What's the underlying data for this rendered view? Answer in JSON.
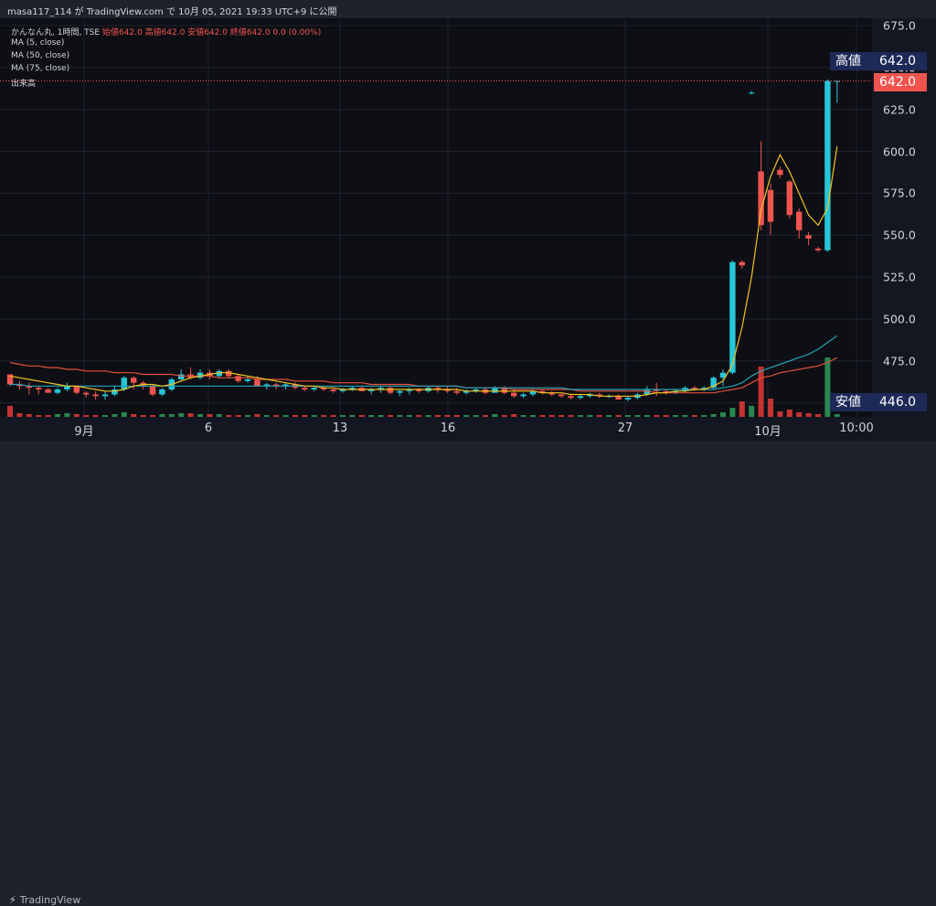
{
  "topbar": {
    "text": "masa117_114 が TradingView.com で 10月 05, 2021 19:33 UTC+9 に公開"
  },
  "legend": {
    "title": "かんなん丸, 1時間, TSE",
    "ohlc": "始値642.0 高値642.0 安値642.0 終値642.0 0.0 (0.00%)",
    "ma5": "MA (5, close)",
    "ma50": "MA (50, close)",
    "ma75": "MA (75, close)",
    "volume": "出来高"
  },
  "price_labels": {
    "high_label": "高値",
    "high_value": "642.0",
    "last_value": "642.0",
    "low_label": "安値",
    "low_value": "446.0"
  },
  "footer": {
    "brand": "TradingView"
  },
  "colors": {
    "up": "#26c6da",
    "down": "#f0544f",
    "ma5": "#f2c21f",
    "ma50": "#26a2b8",
    "ma75": "#e0503c",
    "vol_up": "#2e9c5a",
    "vol_down": "#e53935",
    "label_navy": "#1d2a58"
  },
  "chart_data": {
    "type": "candlestick",
    "ylim": [
      446,
      675
    ],
    "y_ticks": [
      675.0,
      650.0,
      625.0,
      600.0,
      575.0,
      550.0,
      525.0,
      500.0,
      475.0,
      450.0
    ],
    "x_tick_labels": [
      "9月",
      "6",
      "13",
      "16",
      "27",
      "10月",
      "10:00"
    ],
    "candles": [
      [
        467,
        467,
        460,
        461
      ],
      [
        461,
        463,
        458,
        460
      ],
      [
        460,
        462,
        455,
        459
      ],
      [
        459,
        460,
        455,
        458
      ],
      [
        458,
        459,
        457,
        456
      ],
      [
        456,
        459,
        455,
        458
      ],
      [
        458,
        462,
        457,
        460
      ],
      [
        460,
        460,
        455,
        456
      ],
      [
        456,
        457,
        453,
        455
      ],
      [
        455,
        457,
        452,
        454
      ],
      [
        454,
        457,
        452,
        455
      ],
      [
        455,
        460,
        454,
        458
      ],
      [
        458,
        466,
        457,
        465
      ],
      [
        465,
        466,
        458,
        462
      ],
      [
        462,
        463,
        458,
        460
      ],
      [
        460,
        461,
        454,
        455
      ],
      [
        455,
        459,
        454,
        458
      ],
      [
        458,
        465,
        457,
        464
      ],
      [
        464,
        470,
        463,
        467
      ],
      [
        467,
        471,
        464,
        465
      ],
      [
        465,
        470,
        464,
        468
      ],
      [
        468,
        470,
        464,
        466
      ],
      [
        466,
        470,
        465,
        469
      ],
      [
        469,
        470,
        465,
        466
      ],
      [
        466,
        467,
        462,
        463
      ],
      [
        463,
        466,
        462,
        464
      ],
      [
        464,
        466,
        460,
        460
      ],
      [
        460,
        462,
        458,
        461
      ],
      [
        461,
        462,
        458,
        460
      ],
      [
        460,
        462,
        458,
        461
      ],
      [
        461,
        462,
        458,
        459
      ],
      [
        459,
        460,
        457,
        458
      ],
      [
        458,
        460,
        457,
        459
      ],
      [
        459,
        460,
        457,
        458
      ],
      [
        458,
        459,
        456,
        457
      ],
      [
        457,
        459,
        456,
        458
      ],
      [
        458,
        460,
        457,
        459
      ],
      [
        459,
        460,
        457,
        457
      ],
      [
        457,
        459,
        455,
        458
      ],
      [
        458,
        460,
        456,
        459
      ],
      [
        459,
        460,
        455,
        456
      ],
      [
        456,
        458,
        454,
        457
      ],
      [
        457,
        459,
        455,
        458
      ],
      [
        458,
        459,
        456,
        457
      ],
      [
        457,
        460,
        456,
        459
      ],
      [
        459,
        460,
        456,
        458
      ],
      [
        458,
        460,
        456,
        457
      ],
      [
        457,
        459,
        455,
        456
      ],
      [
        456,
        458,
        455,
        457
      ],
      [
        457,
        459,
        456,
        458
      ],
      [
        458,
        459,
        455,
        456
      ],
      [
        456,
        460,
        456,
        459
      ],
      [
        459,
        460,
        455,
        456
      ],
      [
        456,
        458,
        453,
        454
      ],
      [
        454,
        456,
        453,
        455
      ],
      [
        455,
        458,
        454,
        457
      ],
      [
        457,
        458,
        455,
        456
      ],
      [
        456,
        457,
        454,
        455
      ],
      [
        455,
        456,
        453,
        454
      ],
      [
        454,
        455,
        452,
        453
      ],
      [
        453,
        455,
        452,
        454
      ],
      [
        454,
        456,
        453,
        455
      ],
      [
        455,
        456,
        453,
        454
      ],
      [
        454,
        455,
        453,
        454
      ],
      [
        454,
        455,
        452,
        452
      ],
      [
        452,
        454,
        451,
        453
      ],
      [
        453,
        456,
        452,
        455
      ],
      [
        455,
        460,
        454,
        458
      ],
      [
        458,
        462,
        454,
        457
      ],
      [
        457,
        458,
        455,
        456
      ],
      [
        456,
        458,
        455,
        457
      ],
      [
        457,
        460,
        456,
        459
      ],
      [
        459,
        460,
        457,
        458
      ],
      [
        458,
        460,
        457,
        459
      ],
      [
        459,
        466,
        458,
        465
      ],
      [
        465,
        470,
        460,
        468
      ],
      [
        468,
        535,
        467,
        534
      ],
      [
        534,
        535,
        530,
        532
      ],
      [
        635,
        636,
        634,
        635
      ],
      [
        588,
        606,
        553,
        556
      ],
      [
        577,
        581,
        550,
        558
      ],
      [
        589,
        591,
        584,
        586
      ],
      [
        582,
        583,
        560,
        562
      ],
      [
        564,
        566,
        548,
        553
      ],
      [
        550,
        552,
        544,
        548
      ],
      [
        542,
        543,
        540,
        541
      ],
      [
        541,
        643,
        540,
        642
      ],
      [
        642,
        642,
        629,
        642
      ]
    ],
    "ma5": [
      466,
      465,
      464,
      463,
      462,
      461,
      460,
      460,
      459,
      458,
      457,
      457,
      458,
      460,
      461,
      461,
      460,
      461,
      463,
      465,
      466,
      467,
      468,
      468,
      467,
      466,
      465,
      464,
      463,
      462,
      461,
      460,
      460,
      459,
      459,
      458,
      458,
      458,
      458,
      458,
      458,
      458,
      458,
      458,
      458,
      458,
      458,
      458,
      457,
      457,
      457,
      457,
      457,
      457,
      457,
      457,
      456,
      456,
      456,
      455,
      455,
      455,
      454,
      454,
      454,
      454,
      454,
      455,
      456,
      456,
      457,
      457,
      458,
      458,
      460,
      463,
      473,
      495,
      525,
      565,
      585,
      598,
      588,
      575,
      562,
      556,
      566,
      603
    ],
    "ma50": [
      461,
      461,
      460,
      460,
      460,
      460,
      460,
      460,
      460,
      460,
      460,
      460,
      460,
      460,
      460,
      460,
      460,
      460,
      460,
      460,
      460,
      460,
      460,
      460,
      460,
      460,
      460,
      460,
      460,
      460,
      460,
      460,
      460,
      460,
      460,
      460,
      460,
      460,
      460,
      460,
      460,
      460,
      460,
      460,
      460,
      460,
      460,
      460,
      459,
      459,
      459,
      459,
      459,
      459,
      459,
      459,
      459,
      459,
      459,
      458,
      458,
      458,
      458,
      458,
      458,
      458,
      458,
      458,
      458,
      458,
      458,
      458,
      458,
      458,
      458,
      459,
      460,
      462,
      466,
      469,
      471,
      473,
      475,
      477,
      479,
      482,
      486,
      490
    ],
    "ma75": [
      474,
      473,
      472,
      472,
      471,
      471,
      470,
      470,
      469,
      469,
      469,
      468,
      468,
      468,
      467,
      467,
      467,
      467,
      466,
      466,
      466,
      466,
      465,
      465,
      465,
      465,
      464,
      464,
      464,
      464,
      463,
      463,
      463,
      463,
      462,
      462,
      462,
      462,
      461,
      461,
      461,
      461,
      461,
      460,
      460,
      460,
      460,
      460,
      459,
      459,
      459,
      459,
      459,
      458,
      458,
      458,
      458,
      458,
      458,
      458,
      457,
      457,
      457,
      457,
      457,
      457,
      457,
      457,
      456,
      456,
      456,
      456,
      456,
      456,
      456,
      457,
      458,
      459,
      462,
      465,
      466,
      468,
      469,
      470,
      471,
      472,
      474,
      477
    ],
    "volumes": [
      12,
      4,
      3,
      2,
      2,
      3,
      4,
      3,
      2,
      2,
      2,
      3,
      5,
      3,
      2,
      2,
      3,
      3,
      4,
      4,
      3,
      3,
      3,
      2,
      2,
      2,
      3,
      2,
      2,
      2,
      2,
      2,
      2,
      2,
      2,
      2,
      2,
      2,
      2,
      2,
      2,
      2,
      2,
      2,
      2,
      2,
      2,
      2,
      2,
      2,
      2,
      3,
      2,
      3,
      2,
      2,
      2,
      2,
      2,
      2,
      2,
      2,
      2,
      2,
      2,
      2,
      2,
      2,
      2,
      2,
      2,
      2,
      2,
      2,
      3,
      5,
      10,
      17,
      12,
      55,
      20,
      6,
      8,
      5,
      4,
      3,
      65,
      3
    ]
  }
}
